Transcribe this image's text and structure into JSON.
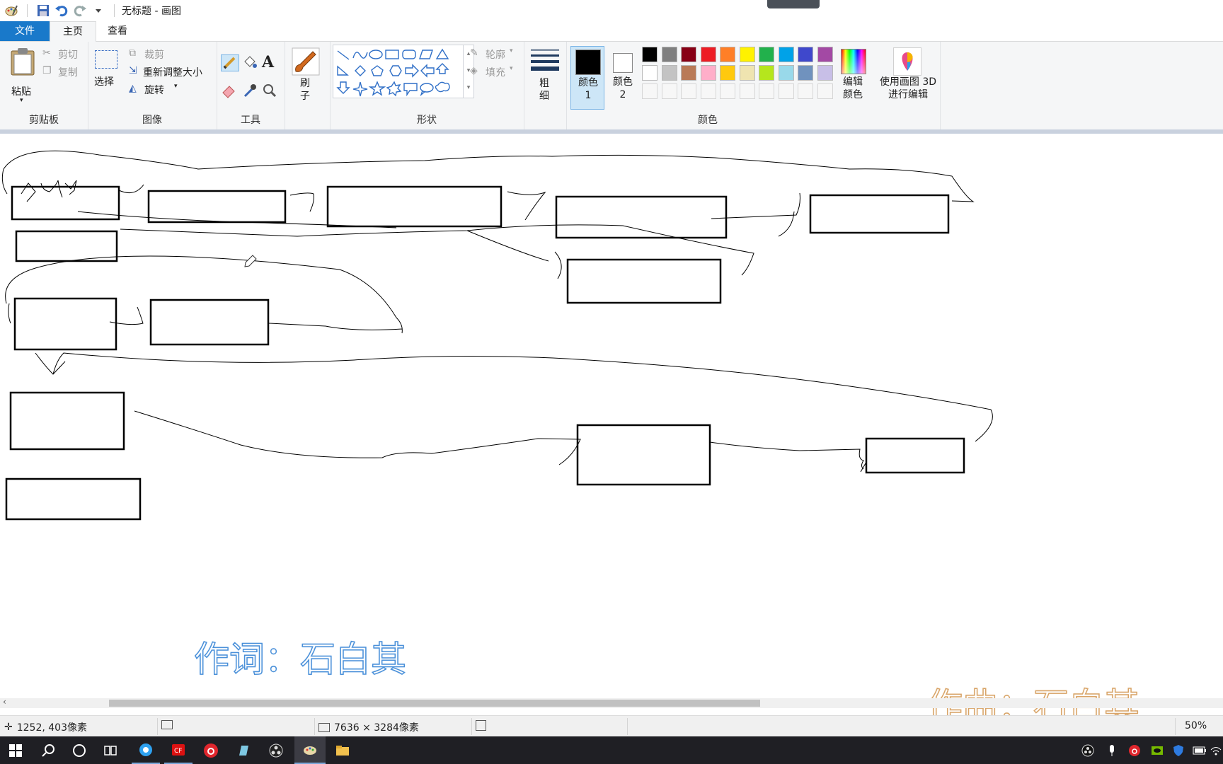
{
  "window": {
    "title": "无标题 - 画图"
  },
  "tabs": {
    "file": "文件",
    "home": "主页",
    "view": "查看"
  },
  "clipboard": {
    "paste": "粘贴",
    "cut": "剪切",
    "copy": "复制",
    "label": "剪贴板"
  },
  "image": {
    "select": "选择",
    "crop": "裁剪",
    "resize": "重新调整大小",
    "rotate": "旋转",
    "label": "图像"
  },
  "tools": {
    "label": "工具"
  },
  "brushes": {
    "label": "刷子"
  },
  "shapes": {
    "outline": "轮廓",
    "fill": "填充",
    "label": "形状"
  },
  "size": {
    "label": "粗细"
  },
  "colors": {
    "color1_label": "颜色 1",
    "color2_label": "颜色 2",
    "edit": "编辑颜色",
    "paint3d": "使用画图 3D 进行编辑",
    "label": "颜色",
    "color1": "#000000",
    "color2": "#ffffff",
    "palette_row1": [
      "#000000",
      "#7f7f7f",
      "#880015",
      "#ed1c24",
      "#ff7f27",
      "#fff200",
      "#22b14c",
      "#00a2e8",
      "#3f48cc",
      "#a349a4"
    ],
    "palette_row2": [
      "#ffffff",
      "#c3c3c3",
      "#b97a57",
      "#ffaec9",
      "#ffc90e",
      "#efe4b0",
      "#b5e61d",
      "#99d9ea",
      "#7092be",
      "#c8bfe7"
    ]
  },
  "canvas": {
    "scribble": "4141"
  },
  "watermarks": {
    "lyrics": "作词：石白其",
    "composer": "作曲：石白其"
  },
  "status": {
    "cursor": "1252, 403像素",
    "dimensions": "7636 × 3284像素",
    "zoom": "50%"
  }
}
